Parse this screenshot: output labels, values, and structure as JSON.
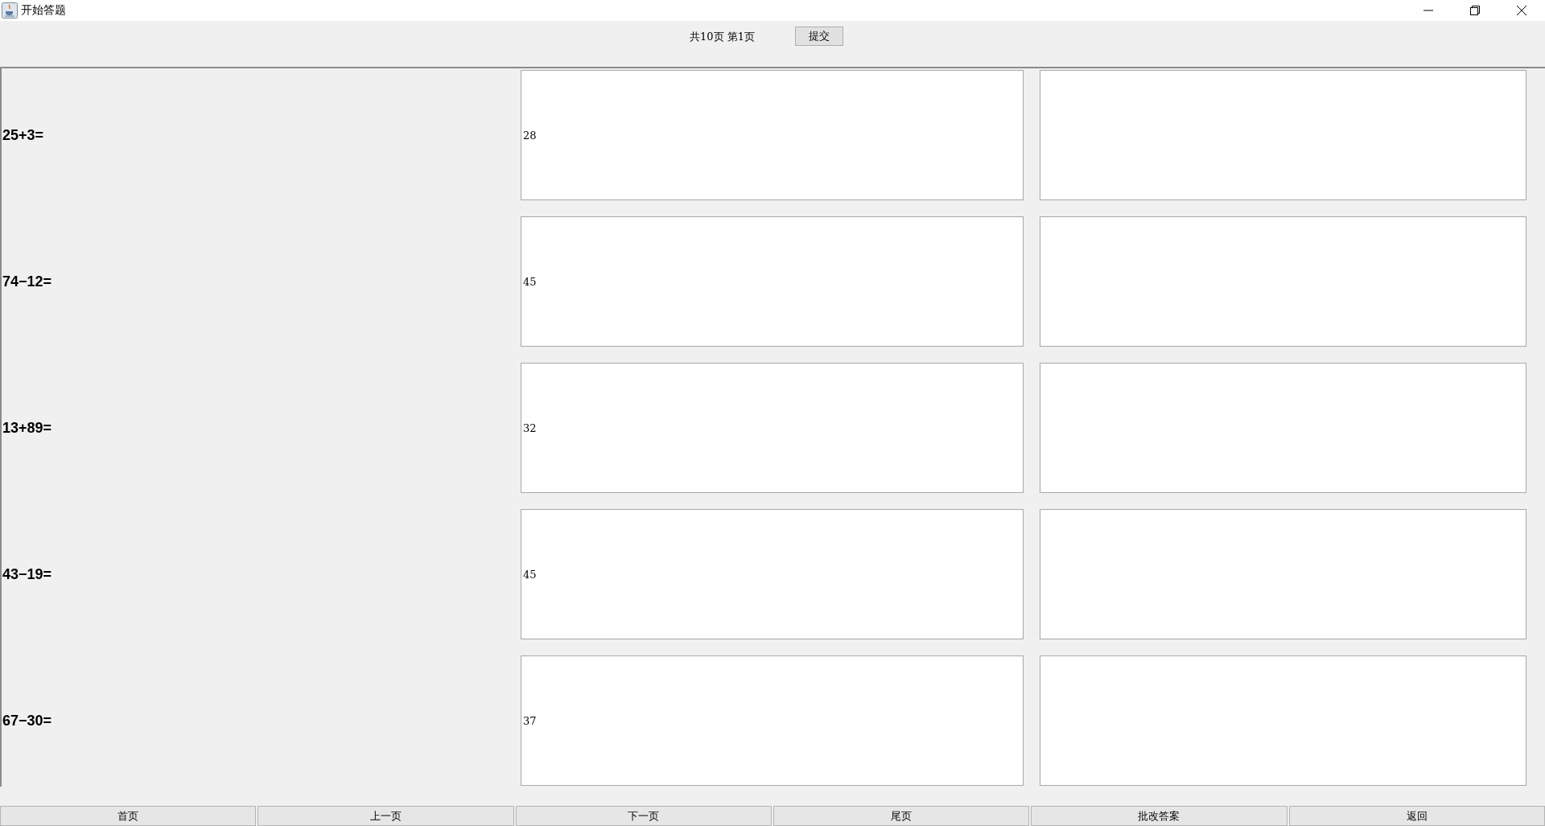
{
  "window": {
    "title": "开始答题"
  },
  "header": {
    "page_info": "共10页 第1页",
    "submit_button": "提交"
  },
  "questions": [
    {
      "question": "25+3=",
      "answer": "28"
    },
    {
      "question": "74−12=",
      "answer": "45"
    },
    {
      "question": "13+89=",
      "answer": "32"
    },
    {
      "question": "43−19=",
      "answer": "45"
    },
    {
      "question": "67−30=",
      "answer": "37"
    }
  ],
  "footer_buttons": [
    "首页",
    "上一页",
    "下一页",
    "尾页",
    "批改答案",
    "返回"
  ]
}
